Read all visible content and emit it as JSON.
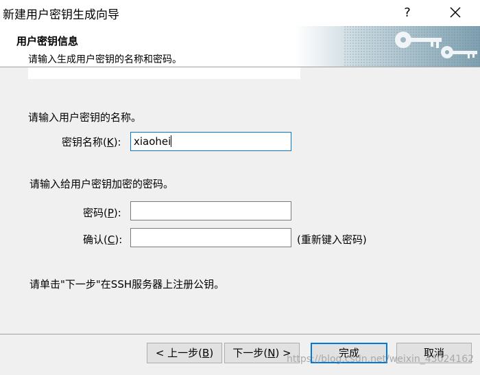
{
  "window": {
    "title": "新建用户密钥生成向导",
    "help_label": "?"
  },
  "header": {
    "title": "用户密钥信息",
    "subtitle": "请输入生成用户密钥的名称和密码。"
  },
  "name_section": {
    "prompt": "请输入用户密钥的名称。",
    "label_text": "密钥名称(",
    "label_mnemonic": "K",
    "label_suffix": "):",
    "value": "xiaohei"
  },
  "password_section": {
    "prompt": "请输入给用户密钥加密的密码。",
    "password_label_text": "密码(",
    "password_mnemonic": "P",
    "password_suffix": "):",
    "password_value": "",
    "confirm_label_text": "确认(",
    "confirm_mnemonic": "C",
    "confirm_suffix": "):",
    "confirm_value": "",
    "confirm_hint": "(重新键入密码)"
  },
  "instruction": "请单击\"下一步\"在SSH服务器上注册公钥。",
  "buttons": {
    "back_prefix": "< 上一步(",
    "back_mnemonic": "B",
    "back_suffix": ")",
    "next_prefix": "下一步(",
    "next_mnemonic": "N",
    "next_suffix": ") >",
    "finish": "完成",
    "cancel": "取消"
  },
  "watermark": "https://blog.csdn.net/weixin_43024162",
  "colors": {
    "accent": "#0078d7",
    "panel": "#f0f0f0",
    "header_art": "#9fb8c4"
  },
  "icons": {
    "close": "close-icon",
    "help": "help-icon",
    "header_art": "keys-icon"
  }
}
